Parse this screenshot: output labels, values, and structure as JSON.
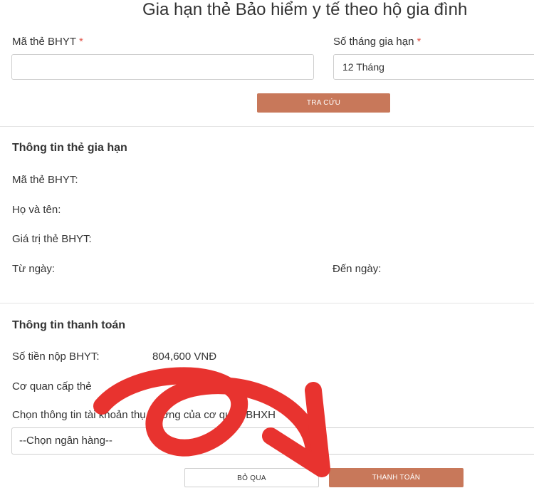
{
  "page": {
    "title": "Gia hạn thẻ Bảo hiểm y tế theo hộ gia đình"
  },
  "form": {
    "card_number_label": "Mã thẻ BHYT",
    "card_number_required": "*",
    "card_number_value": "",
    "months_label": "Số tháng gia hạn",
    "months_required": "*",
    "months_value": "12 Tháng",
    "lookup_button": "TRA CỨU"
  },
  "renewal_info": {
    "heading": "Thông tin thẻ gia hạn",
    "card_number_label": "Mã thẻ BHYT:",
    "full_name_label": "Họ và tên:",
    "card_value_label": "Giá trị thẻ BHYT:",
    "from_date_label": "Từ ngày:",
    "to_date_label": "Đến ngày:"
  },
  "payment_info": {
    "heading": "Thông tin thanh toán",
    "amount_label": "Số tiền nộp BHYT:",
    "amount_value": "804,600 VNĐ",
    "issuer_label": "Cơ quan cấp thẻ",
    "account_label": "Chọn thông tin tài khoản thụ hưởng của cơ quan BHXH",
    "bank_select_value": "--Chọn ngân hàng--"
  },
  "actions": {
    "skip_button": "BỎ QUA",
    "pay_button": "THANH TOÁN"
  },
  "colors": {
    "accent": "#c8785a",
    "required": "#e2574c",
    "annotation_arrow": "#e8332f"
  },
  "annotation": {
    "type": "red-curved-arrow-pointing-to-pay-button"
  }
}
